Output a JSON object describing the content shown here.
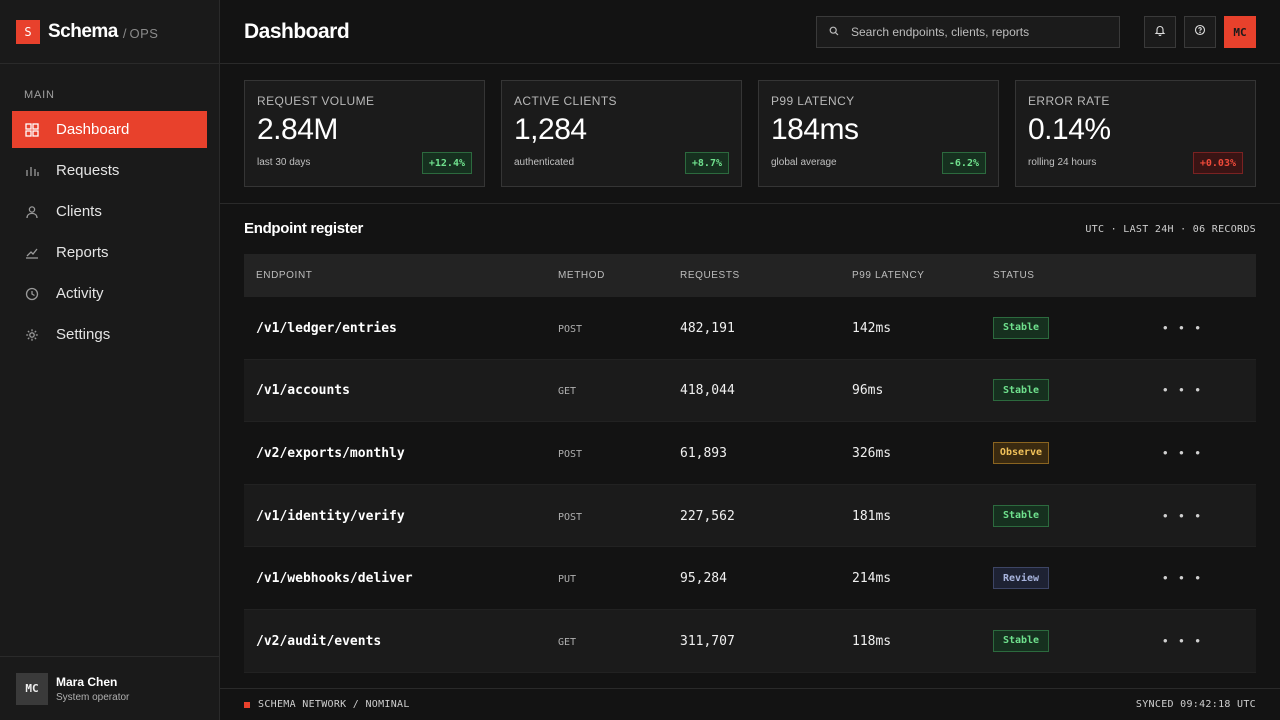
{
  "brand": {
    "logo": "S",
    "name": "Schema",
    "separator": "/",
    "sub": "OPS"
  },
  "sidebar": {
    "section": "MAIN",
    "items": [
      {
        "label": "Dashboard",
        "icon": "grid-icon",
        "active": true
      },
      {
        "label": "Requests",
        "icon": "bar-chart-icon"
      },
      {
        "label": "Clients",
        "icon": "user-icon"
      },
      {
        "label": "Reports",
        "icon": "trend-icon"
      },
      {
        "label": "Activity",
        "icon": "clock-icon"
      },
      {
        "label": "Settings",
        "icon": "gear-icon"
      }
    ],
    "user": {
      "initials": "MC",
      "name": "Mara Chen",
      "role": "System operator"
    }
  },
  "header": {
    "title": "Dashboard",
    "search_placeholder": "Search endpoints, clients, reports",
    "avatar": "MC"
  },
  "kpis": [
    {
      "label": "REQUEST VOLUME",
      "value": "2.84M",
      "note": "last 30 days",
      "delta": "+12.4%",
      "trend": "up"
    },
    {
      "label": "ACTIVE CLIENTS",
      "value": "1,284",
      "note": "authenticated",
      "delta": "+8.7%",
      "trend": "up"
    },
    {
      "label": "P99 LATENCY",
      "value": "184ms",
      "note": "global average",
      "delta": "-6.2%",
      "trend": "up"
    },
    {
      "label": "ERROR RATE",
      "value": "0.14%",
      "note": "rolling 24 hours",
      "delta": "+0.03%",
      "trend": "down"
    }
  ],
  "register": {
    "title": "Endpoint register",
    "meta": "UTC · LAST 24H · 06 RECORDS",
    "columns": [
      "ENDPOINT",
      "METHOD",
      "REQUESTS",
      "P99 LATENCY",
      "STATUS"
    ],
    "rows": [
      {
        "endpoint": "/v1/ledger/entries",
        "method": "POST",
        "requests": "482,191",
        "latency": "142ms",
        "status": "Stable"
      },
      {
        "endpoint": "/v1/accounts",
        "method": "GET",
        "requests": "418,044",
        "latency": "96ms",
        "status": "Stable"
      },
      {
        "endpoint": "/v2/exports/monthly",
        "method": "POST",
        "requests": "61,893",
        "latency": "326ms",
        "status": "Observe"
      },
      {
        "endpoint": "/v1/identity/verify",
        "method": "POST",
        "requests": "227,562",
        "latency": "181ms",
        "status": "Stable"
      },
      {
        "endpoint": "/v1/webhooks/deliver",
        "method": "PUT",
        "requests": "95,284",
        "latency": "214ms",
        "status": "Review"
      },
      {
        "endpoint": "/v2/audit/events",
        "method": "GET",
        "requests": "311,707",
        "latency": "118ms",
        "status": "Stable"
      }
    ],
    "action_label": "• • •"
  },
  "footer": {
    "left": "SCHEMA NETWORK / NOMINAL",
    "right": "SYNCED 09:42:18 UTC"
  },
  "colors": {
    "accent": "#e8412c",
    "success": "#6fe08d",
    "warning": "#f2c25a",
    "review": "#a8b4dd",
    "danger": "#f04a3a"
  }
}
